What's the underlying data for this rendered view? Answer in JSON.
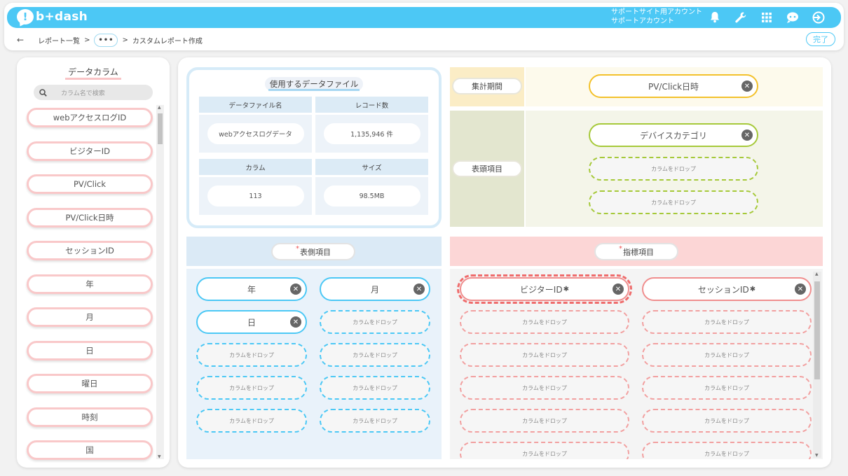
{
  "app": {
    "brand": "b+dash",
    "account_line1": "サポートサイト用アカウント",
    "account_line2": "サポートアカウント"
  },
  "header_icons": [
    "bell-icon",
    "wrench-icon",
    "grid-icon",
    "chat-bot-icon",
    "logout-icon"
  ],
  "breadcrumb": {
    "back": "←",
    "first": "レポート一覧",
    "sep": ">",
    "ellipsis": "•••",
    "current": "カスタムレポート作成"
  },
  "done_label": "完了",
  "left": {
    "title": "データカラム",
    "search_placeholder": "カラム名で検索",
    "columns": [
      "webアクセスログID",
      "ビジターID",
      "PV/Click",
      "PV/Click日時",
      "セッションID",
      "年",
      "月",
      "日",
      "曜日",
      "時刻",
      "国"
    ]
  },
  "datafile": {
    "title": "使用するデータファイル",
    "h_name": "データファイル名",
    "h_records": "レコード数",
    "v_name": "webアクセスログデータ",
    "v_records": "1,135,946 件",
    "h_columns": "カラム",
    "h_size": "サイズ",
    "v_columns": "113",
    "v_size": "98.5MB"
  },
  "period": {
    "label": "集計期間",
    "value": "PV/Click日時"
  },
  "head": {
    "label": "表頭項目",
    "value": "デバイスカテゴリ",
    "drops": [
      "カラムをドロップ",
      "カラムをドロップ"
    ]
  },
  "side": {
    "label": "表側項目",
    "required_mark": "*",
    "items": [
      "年",
      "月",
      "日"
    ],
    "drop_label": "カラムをドロップ"
  },
  "metric": {
    "label": "指標項目",
    "required_mark": "*",
    "items": [
      "ビジターID",
      "セッションID"
    ],
    "gear": "✱",
    "drop_label": "カラムをドロップ"
  },
  "colors": {
    "accent": "#4cc8f5",
    "side_border": "#4cc8f5",
    "metric_border": "#f08e8e",
    "period_border": "#f3c12b",
    "head_border": "#a6c93a"
  }
}
